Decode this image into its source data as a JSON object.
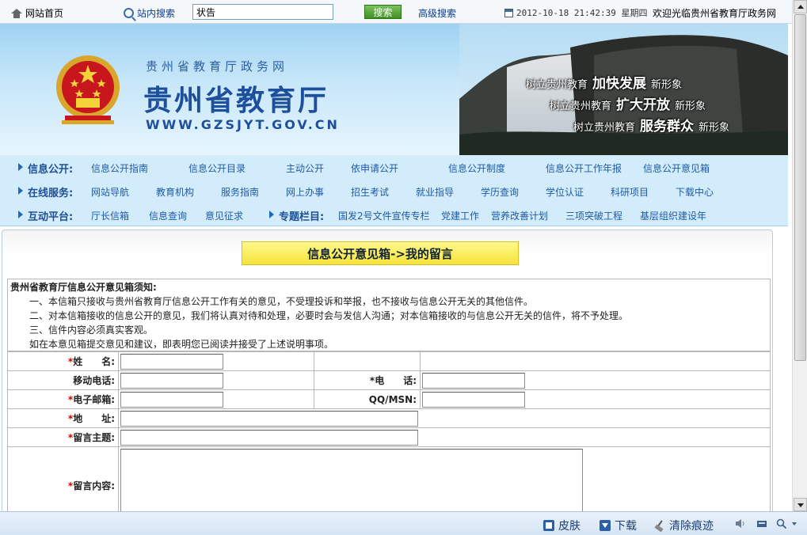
{
  "topbar": {
    "home_label": "网站首页",
    "site_search_label": "站内搜索",
    "search_value": "状告",
    "search_button": "搜索",
    "advanced_search": "高级搜索",
    "datetime": "2012-10-18 21:42:39 星期四",
    "welcome": "欢迎光临贵州省教育厅政务网"
  },
  "banner": {
    "subtitle": "贵州省教育厅政务网",
    "title": "贵州省教育厅",
    "url": "WWW.GZSJYT.GOV.CN",
    "slogans": [
      {
        "pre": "树立贵州教育",
        "bold": "加快发展",
        "post": "新形象"
      },
      {
        "pre": "树立贵州教育",
        "bold": "扩大开放",
        "post": "新形象"
      },
      {
        "pre": "树立贵州教育",
        "bold": "服务群众",
        "post": "新形象"
      }
    ]
  },
  "nav": {
    "row1": {
      "head": "信息公开:",
      "links": [
        "信息公开指南",
        "信息公开目录",
        "主动公开",
        "依申请公开",
        "信息公开制度",
        "信息公开工作年报",
        "信息公开意见箱"
      ]
    },
    "row2": {
      "head": "在线服务:",
      "links": [
        "网站导航",
        "教育机构",
        "服务指南",
        "网上办事",
        "招生考试",
        "就业指导",
        "学历查询",
        "学位认证",
        "科研项目",
        "下载中心"
      ]
    },
    "row3": {
      "head": "互动平台:",
      "links": [
        "厅长信箱",
        "信息查询",
        "意见征求"
      ],
      "head2": "专题栏目:",
      "links2": [
        "国发2号文件宣传专栏",
        "党建工作",
        "营养改善计划",
        "三项突破工程",
        "基层组织建设年"
      ]
    }
  },
  "page": {
    "title": "信息公开意见箱->我的留言",
    "notice_title": "贵州省教育厅信息公开意见箱须知:",
    "notice_lines": [
      "一、本信箱只接收与贵州省教育厅信息公开工作有关的意见，不受理投诉和举报，也不接收与信息公开无关的其他信件。",
      "二、对本信箱接收的信息公开的意见，我们将认真对待和处理，必要时会与发信人沟通；对本信箱接收的与信息公开无关的信件，将不予处理。",
      "三、信件内容必须真实客观。",
      "如在本意见箱提交意见和建议，即表明您已阅读并接受了上述说明事项。"
    ]
  },
  "form": {
    "star": "*",
    "name_label": "姓　　名:",
    "mobile_label": "移动电话:",
    "phone_label": "电　　话:",
    "email_label": "电子邮箱:",
    "qq_label": "QQ/MSN:",
    "address_label": "地　　址:",
    "subject_label": "留言主题:",
    "content_label": "留言内容:"
  },
  "statusbar": {
    "skin": "皮肤",
    "download": "下载",
    "clear": "清除痕迹"
  }
}
